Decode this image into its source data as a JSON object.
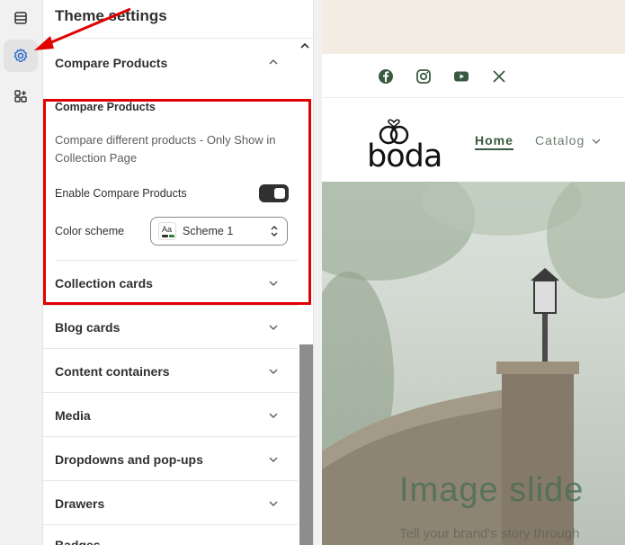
{
  "colors": {
    "accent": "#3a5a40",
    "highlight_border": "#e10000",
    "toggle_on": "#303030",
    "announcement_bg": "#f3ece2"
  },
  "rail": {
    "items": [
      {
        "name": "sections-icon"
      },
      {
        "name": "theme-settings-gear-icon",
        "active": true
      },
      {
        "name": "apps-icon"
      }
    ]
  },
  "panel": {
    "title": "Theme settings",
    "compare_section": {
      "header": "Compare Products",
      "sub_title": "Compare Products",
      "description": "Compare different products - Only Show in Collection Page",
      "toggle_label": "Enable Compare Products",
      "toggle_on": true,
      "scheme_label": "Color scheme",
      "scheme_value": "Scheme 1",
      "scheme_swatch_text": "Aa"
    },
    "sections": [
      "Collection cards",
      "Blog cards",
      "Content containers",
      "Media",
      "Dropdowns and pop-ups",
      "Drawers",
      "Badges"
    ]
  },
  "preview": {
    "social_icons": [
      "facebook-icon",
      "instagram-icon",
      "youtube-icon",
      "x-icon"
    ],
    "logo": "boda",
    "nav": {
      "home": "Home",
      "catalog": "Catalog"
    },
    "hero": {
      "title": "Image slide",
      "subtitle": "Tell your brand's story through"
    }
  }
}
